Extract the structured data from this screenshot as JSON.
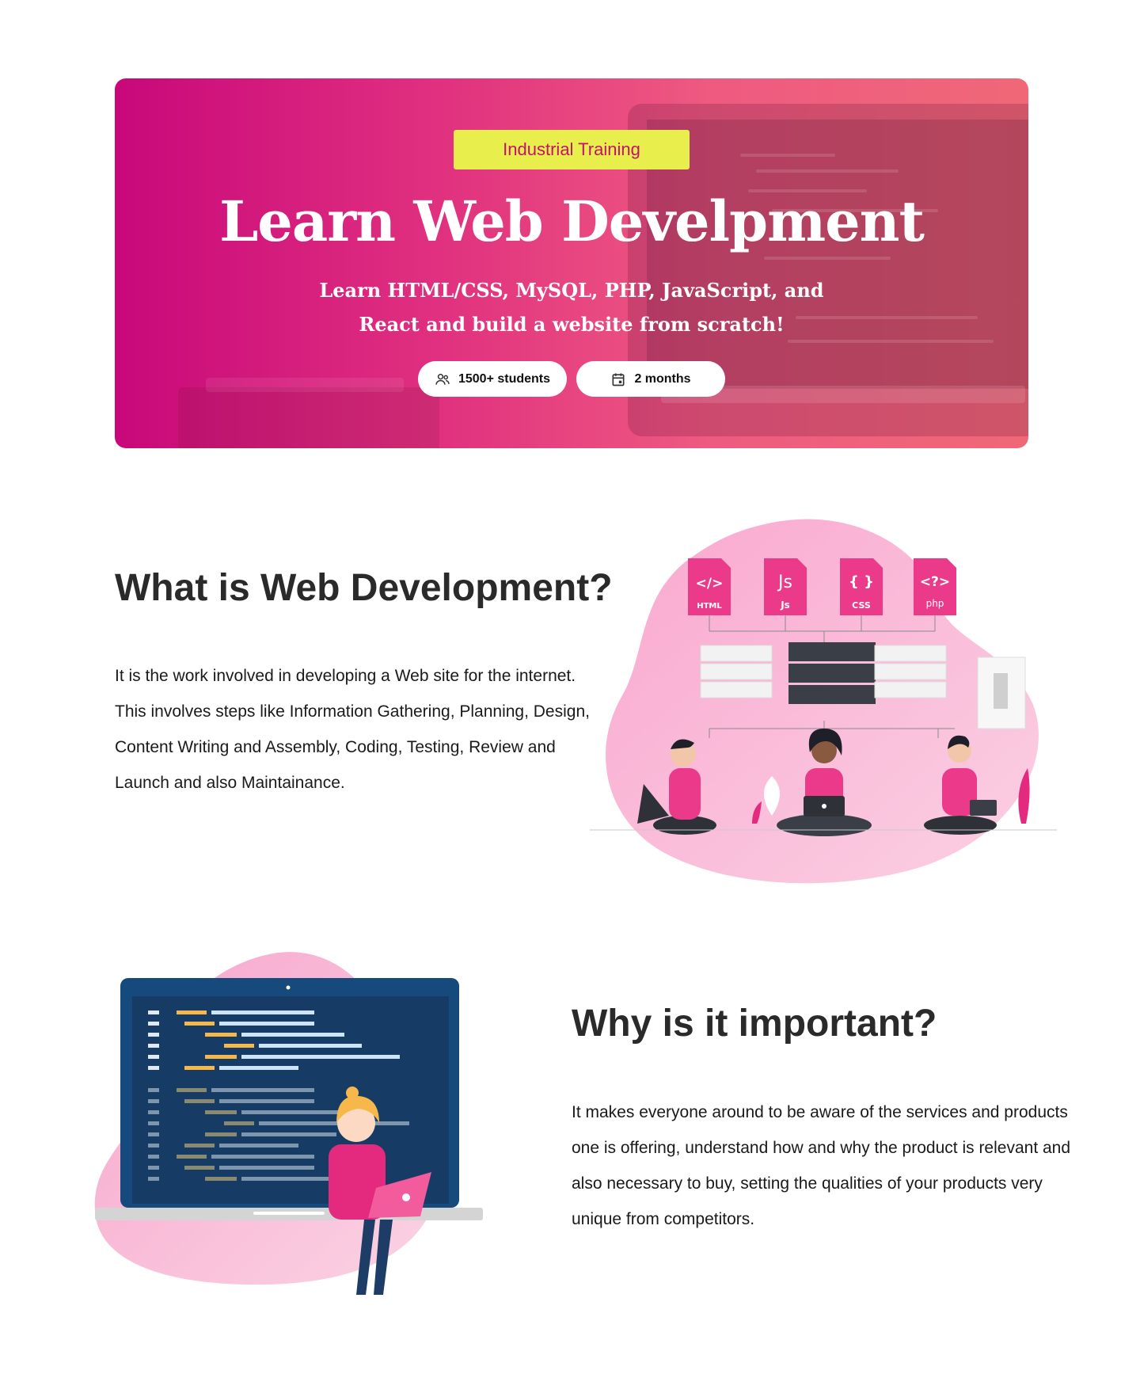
{
  "hero": {
    "badge": "Industrial Training",
    "title": "Learn Web Develpment",
    "subtitle_line1": "Learn HTML/CSS, MySQL, PHP, JavaScript, and",
    "subtitle_line2": "React and build a website from scratch!",
    "students": "1500+ students",
    "duration": "2 months",
    "colors": {
      "gradient_start": "#c8087a",
      "gradient_end": "#f06878",
      "badge_bg": "#e8ef4d",
      "badge_text": "#c4126a"
    },
    "icons": {
      "students": "users-icon",
      "duration": "calendar-icon"
    }
  },
  "section_what": {
    "heading": "What is Web Development?",
    "body": "It is the work involved in developing a Web site for the internet. This involves steps like Information Gathering, Planning, Design, Content Writing and Assembly, Coding, Testing, Review and Launch and also Maintainance.",
    "file_labels": [
      {
        "glyph": "</>",
        "caption": "HTML"
      },
      {
        "glyph": "Js",
        "caption": "Js"
      },
      {
        "glyph": "{ }",
        "caption": "CSS"
      },
      {
        "glyph": "<?>",
        "caption": "php"
      }
    ]
  },
  "section_why": {
    "heading": "Why is it important?",
    "body": "It makes everyone around to be aware of the services and products one is offering, understand how and why the product is relevant and also necessary to buy, setting the qualities of your products very unique from competitors."
  }
}
